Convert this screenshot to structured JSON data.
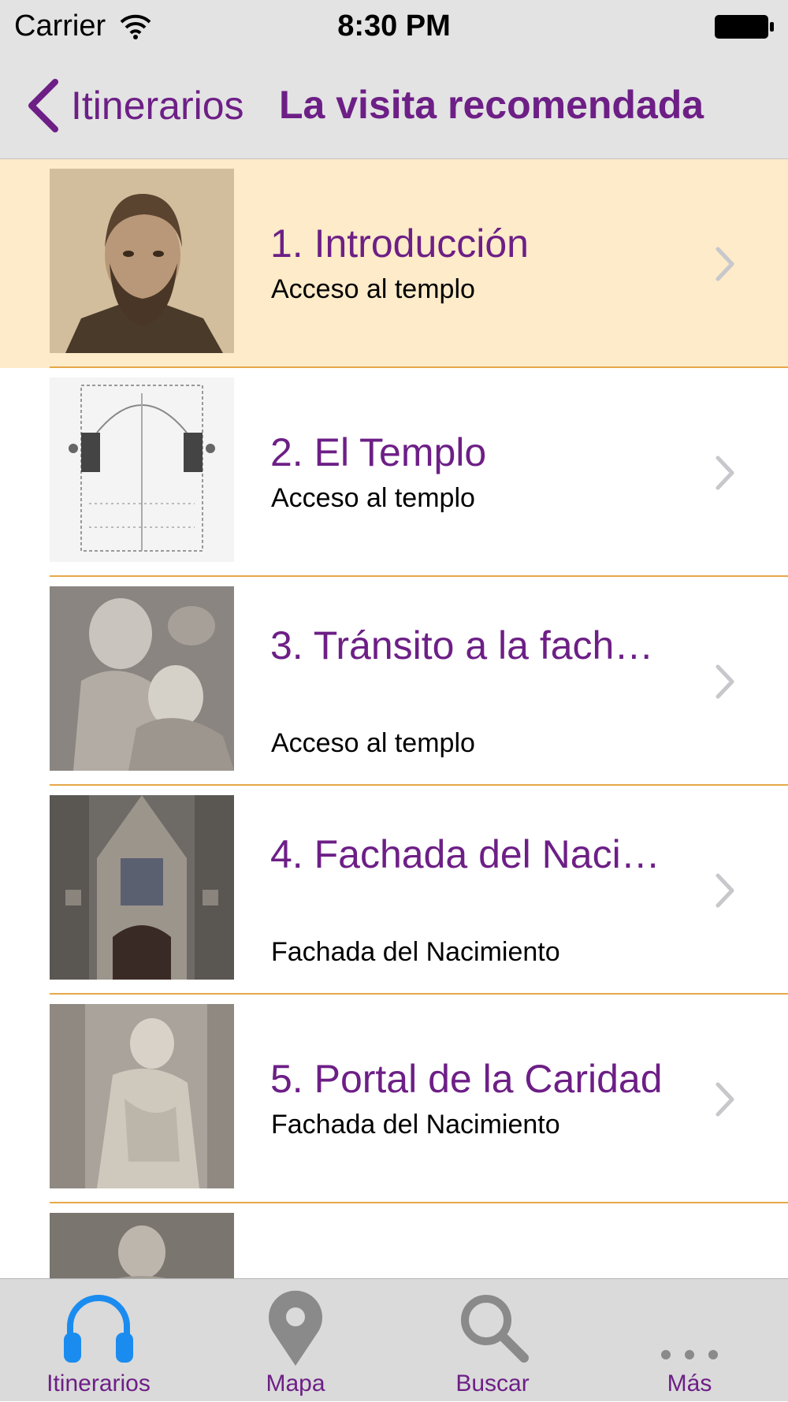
{
  "status_bar": {
    "carrier": "Carrier",
    "time": "8:30 PM"
  },
  "nav": {
    "back_label": "Itinerarios",
    "title": "La visita recomendada"
  },
  "colors": {
    "accent": "#6d1f86",
    "selected_row": "#fdebc9",
    "separator": "#e7a84a",
    "tab_active": "#1a8cf0",
    "tab_inactive": "#8a8a8a"
  },
  "rows": [
    {
      "title": "1. Introducción",
      "subtitle": "Acceso al templo",
      "thumbnail": "portrait-photo",
      "selected": true
    },
    {
      "title": "2. El Templo",
      "subtitle": "Acceso al templo",
      "thumbnail": "floor-plan-drawing"
    },
    {
      "title": "3. Tránsito a la fach…",
      "subtitle": "Acceso al templo",
      "thumbnail": "sculpture-photo"
    },
    {
      "title": "4. Fachada del Naci…",
      "subtitle": "Fachada del Nacimiento",
      "thumbnail": "facade-photo"
    },
    {
      "title": "5. Portal de la Caridad",
      "subtitle": "Fachada del Nacimiento",
      "thumbnail": "statue-photo"
    },
    {
      "title": "",
      "subtitle": "",
      "thumbnail": "statue-photo"
    }
  ],
  "tabs": [
    {
      "label": "Itinerarios",
      "icon": "headphones-icon",
      "active": true
    },
    {
      "label": "Mapa",
      "icon": "map-pin-icon"
    },
    {
      "label": "Buscar",
      "icon": "search-icon"
    },
    {
      "label": "Más",
      "icon": "more-icon"
    }
  ]
}
